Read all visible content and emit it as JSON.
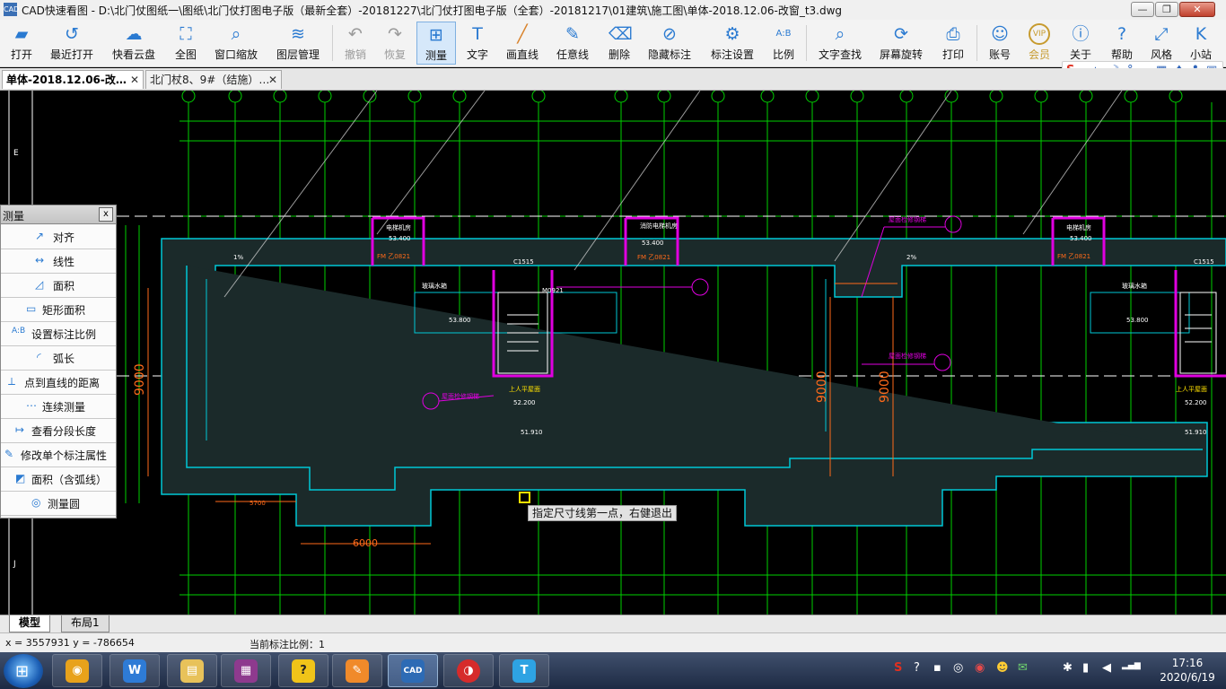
{
  "window": {
    "title": "CAD快速看图 - D:\\北门仗图纸一\\图纸\\北门仗打图电子版（最新全套）-20181227\\北门仗打图电子版（全套）-20181217\\01建筑\\施工图\\单体-2018.12.06-改窗_t3.dwg",
    "app_icon_text": "CAD",
    "min_glyph": "—",
    "max_glyph": "❐",
    "close_glyph": "✕"
  },
  "toolbar": {
    "open": "打开",
    "recent": "最近打开",
    "cloud": "快看云盘",
    "full_view": "全图",
    "window_zoom": "窗口缩放",
    "layer_manager": "图层管理",
    "undo": "撤销",
    "redo": "恢复",
    "measure": "测量",
    "text": "文字",
    "line": "画直线",
    "freehand": "任意线",
    "erase": "删除",
    "hide_dims": "隐藏标注",
    "dim_settings": "标注设置",
    "scale": "比例",
    "text_search": "文字查找",
    "rotate_screen": "屏幕旋转",
    "print": "打印",
    "account": "账号",
    "member": "会员",
    "about": "关于",
    "help": "帮助",
    "style": "风格",
    "mini_site": "小站",
    "vip_badge": "VIP",
    "text_icon_glyph": "T",
    "scale_icon_glyph": "A:B"
  },
  "ime": {
    "logo": "S",
    "mode": "中",
    "glyphs": [
      "☽",
      "°",
      "，",
      "▦",
      "♠",
      "♣",
      "▣"
    ]
  },
  "tabs": [
    {
      "label": "单体-2018.12.06-改…",
      "close": "✕"
    },
    {
      "label": "北门杖8、9#（结施）…",
      "close": "✕"
    }
  ],
  "drawing": {
    "axis_letters": [
      "E",
      "E",
      "J"
    ],
    "room_labels": [
      "电梯机房",
      "消防电梯机房",
      "电梯机房",
      "53.400",
      "53.400",
      "53.400",
      "FM 乙0821",
      "FM 乙0821",
      "FM 乙0821",
      "C1515",
      "C1515",
      "M0921",
      "上人平屋面",
      "上人平屋面",
      "52.200",
      "52.200",
      "51.910",
      "51.910",
      "玻璃水箱",
      "玻璃水箱",
      "53.800",
      "53.800",
      "屋面检修钢梯",
      "屋面检修钢梯",
      "屋面检修钢梯",
      "1%",
      "2%"
    ],
    "dimensions": {
      "vert_1": "9000",
      "vert_2": "9000",
      "vert_3": "9000",
      "horiz_1": "6000",
      "horiz_2": "5700"
    },
    "cursor_hint": "指定尺寸线第一点，右健退出"
  },
  "measure_panel": {
    "title": "测量",
    "close_glyph": "x",
    "items": [
      {
        "label": "对齐",
        "icon": "↗"
      },
      {
        "label": "线性",
        "icon": "↔"
      },
      {
        "label": "面积",
        "icon": "◿"
      },
      {
        "label": "矩形面积",
        "icon": "▭"
      },
      {
        "label": "设置标注比例",
        "icon": "A:B"
      },
      {
        "label": "弧长",
        "icon": "◜"
      },
      {
        "label": "点到直线的距离",
        "icon": "⟂"
      },
      {
        "label": "连续测量",
        "icon": "⋯"
      },
      {
        "label": "查看分段长度",
        "icon": "↦"
      },
      {
        "label": "修改单个标注属性",
        "icon": "✎"
      },
      {
        "label": "面积（含弧线）",
        "icon": "◩"
      },
      {
        "label": "测量圆",
        "icon": "◎"
      }
    ]
  },
  "layout_tabs": [
    "模型",
    "布局1"
  ],
  "status": {
    "coords": "x = 3557931  y = -786654",
    "scale": "当前标注比例：1"
  },
  "taskbar": {
    "start_glyph": "⊞",
    "apps": [
      {
        "name": "chrome",
        "color": "#e8a21b",
        "glyph": "◉"
      },
      {
        "name": "wps",
        "color": "#2e7bd6",
        "glyph": "W"
      },
      {
        "name": "explorer",
        "color": "#e8c25a",
        "glyph": "▤"
      },
      {
        "name": "winrar",
        "color": "#8e3a8e",
        "glyph": "▦"
      },
      {
        "name": "help",
        "color": "#f0c419",
        "glyph": "?"
      },
      {
        "name": "notes",
        "color": "#f08a2a",
        "glyph": "✎"
      },
      {
        "name": "cad",
        "color": "#2d6bb5",
        "glyph": "CAD"
      },
      {
        "name": "netease",
        "color": "#d62b2b",
        "glyph": "◑"
      },
      {
        "name": "t-app",
        "color": "#2ea3e3",
        "glyph": "T"
      }
    ],
    "tray_glyphs": [
      "S",
      "?",
      "▪",
      "◎",
      "◉",
      "☻",
      "✉",
      "✱",
      "▮",
      "◀",
      "▂▄▆"
    ],
    "time": "17:16",
    "date": "2020/6/19"
  },
  "colors": {
    "grid": "#00d000",
    "wall": "#00c8d6",
    "magenta": "#e000e0",
    "white": "#ffffff",
    "yellow": "#ffe100",
    "orange": "#ff6a1a",
    "accent": "#2a7ad1"
  }
}
